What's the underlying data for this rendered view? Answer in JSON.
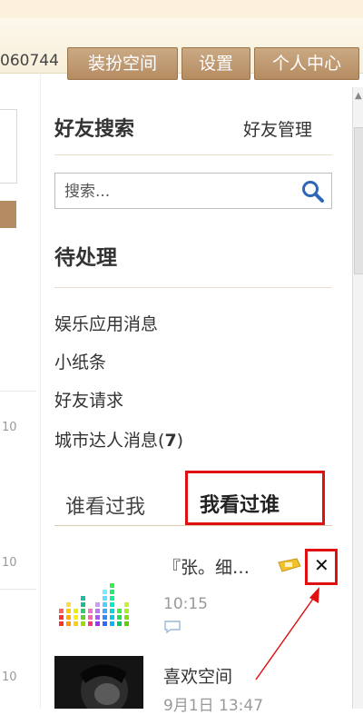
{
  "topbar": {
    "user_id": "060744",
    "dress_label": "装扮空间",
    "settings_label": "设置",
    "center_label": "个人中心"
  },
  "left_panel": {
    "nums": [
      "10",
      "10",
      "10"
    ]
  },
  "friend_search": {
    "title": "好友搜索",
    "manage_label": "好友管理",
    "placeholder": "搜索..."
  },
  "pending": {
    "title": "待处理",
    "items": [
      {
        "label": "娱乐应用消息"
      },
      {
        "label": "小纸条"
      },
      {
        "label": "好友请求"
      },
      {
        "label": "城市达人消息",
        "count": "7"
      }
    ]
  },
  "tabs": {
    "who_viewed_me": "谁看过我",
    "i_viewed": "我看过谁"
  },
  "visits": [
    {
      "name": "『张。细…",
      "time": "10:15"
    },
    {
      "name": "喜欢空间",
      "time": "9月1日 13:47"
    }
  ],
  "colors": {
    "accent_brown": "#b58c61",
    "highlight_red": "#e01010"
  }
}
